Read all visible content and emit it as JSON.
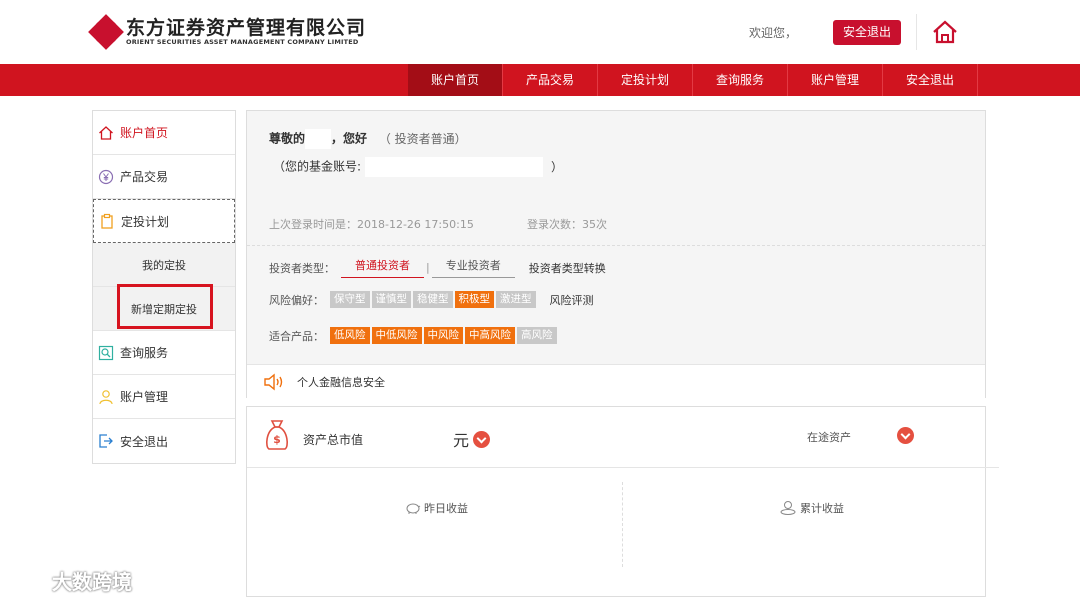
{
  "header": {
    "logo_cn": "东方证券资产管理有限公司",
    "logo_en": "ORIENT SECURITIES ASSET MANAGEMENT COMPANY LIMITED",
    "welcome": "欢迎您，",
    "logout": "安全退出",
    "brand_color": "#c8102e"
  },
  "nav": {
    "items": [
      "账户首页",
      "产品交易",
      "定投计划",
      "查询服务",
      "账户管理",
      "安全退出"
    ],
    "active_index": 0
  },
  "sidebar": {
    "items": [
      {
        "label": "账户首页",
        "icon": "home-icon"
      },
      {
        "label": "产品交易",
        "icon": "yuan-icon"
      },
      {
        "label": "定投计划",
        "icon": "clipboard-icon"
      },
      {
        "label": "查询服务",
        "icon": "query-icon"
      },
      {
        "label": "账户管理",
        "icon": "user-icon"
      },
      {
        "label": "安全退出",
        "icon": "exit-icon"
      }
    ],
    "sub_items": [
      "我的定投",
      "新增定期定投"
    ]
  },
  "info": {
    "greet_prefix": "尊敬的",
    "greet_suffix": "，您好",
    "investor_type_paren": "（ 投资者普通）",
    "account_label": "（您的基金账号:",
    "account_close": "）",
    "last_login": "上次登录时间是：2018-12-26 17:50:15",
    "login_count": "登录次数：35次",
    "investor_type_label": "投资者类型：",
    "investor_tabs": [
      "普通投资者",
      "专业投资者"
    ],
    "investor_convert": "投资者类型转换",
    "risk_label": "风险偏好：",
    "risk_chips": [
      "保守型",
      "谨慎型",
      "稳健型",
      "积极型",
      "激进型"
    ],
    "risk_active": 3,
    "risk_eval": "风险评测",
    "product_label": "适合产品：",
    "product_chips": [
      "低风险",
      "中低风险",
      "中风险",
      "中高风险",
      "高风险"
    ],
    "security_text": "个人金融信息安全"
  },
  "assets": {
    "total_label": "资产总市值",
    "unit": "元",
    "in_transit": "在途资产",
    "yesterday": "昨日收益",
    "cumulative": "累计收益"
  },
  "watermark": "大数跨境",
  "colors": {
    "nav_red": "#d0141f",
    "nav_active": "#a30d16",
    "chip_orange": "#f0700e",
    "chip_grey": "#c8c8c8"
  }
}
